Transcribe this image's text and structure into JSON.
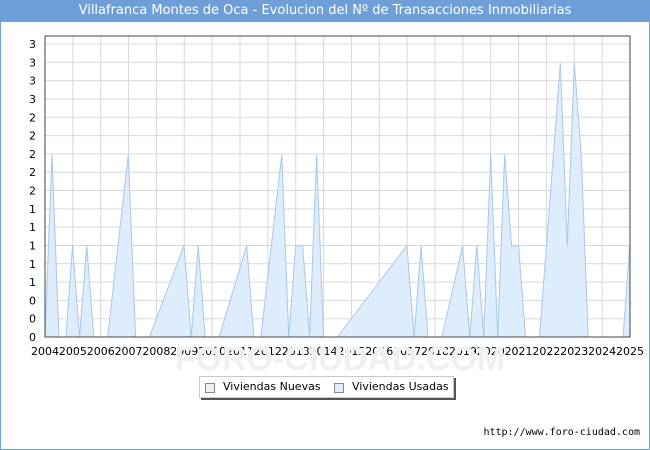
{
  "title": "Villafranca Montes de Oca - Evolucion del Nº de Transacciones Inmobiliarias",
  "watermark": "FORO-CIUDAD.COM",
  "credit": "http://www.foro-ciudad.com",
  "colors": {
    "accent": "#6f9fd8",
    "nuevas_fill": "#f0f0f0",
    "usadas_fill": "#deedfb",
    "usadas_line": "#a8c7ec",
    "grid": "#d8d8d8"
  },
  "chart_data": {
    "type": "area",
    "title": "Villafranca Montes de Oca - Evolucion del Nº de Transacciones Inmobiliarias",
    "xlabel": "",
    "ylabel": "",
    "x_ticks": [
      "2004",
      "2005",
      "2006",
      "2007",
      "2008",
      "2009",
      "2010",
      "2011",
      "2012",
      "2013",
      "2014",
      "2015",
      "2016",
      "2017",
      "2018",
      "2019",
      "2020",
      "2021",
      "2022",
      "2023",
      "2024",
      "2025"
    ],
    "y_ticks": [
      "0",
      "0",
      "0",
      "1",
      "1",
      "1",
      "1",
      "1",
      "2",
      "2",
      "2",
      "2",
      "2",
      "3",
      "3",
      "3",
      "3"
    ],
    "ylim": [
      0,
      3.3
    ],
    "grid": true,
    "legend": "bottom-center",
    "series": [
      {
        "name": "Viviendas Nuevas",
        "x": [],
        "values": []
      },
      {
        "name": "Viviendas Usadas",
        "x": [
          2004.0,
          2004.25,
          2004.5,
          2004.75,
          2004.99,
          2005.24,
          2005.5,
          2005.75,
          2006.0,
          2006.25,
          2006.99,
          2007.25,
          2007.5,
          2007.75,
          2008.99,
          2009.25,
          2009.5,
          2009.75,
          2010.0,
          2010.25,
          2011.24,
          2011.5,
          2011.75,
          2012.5,
          2012.75,
          2013.0,
          2013.25,
          2013.5,
          2013.75,
          2014.0,
          2014.25,
          2014.5,
          2016.99,
          2017.25,
          2017.5,
          2017.75,
          2018.0,
          2018.25,
          2018.99,
          2019.25,
          2019.5,
          2019.75,
          2020.0,
          2020.25,
          2020.5,
          2020.75,
          2021.0,
          2021.25,
          2021.5,
          2021.75,
          2022.5,
          2022.75,
          2023.0,
          2023.25,
          2023.5,
          2023.75,
          2024.75,
          2024.99
        ],
        "values": [
          0,
          2,
          0,
          0,
          1,
          0,
          1,
          0,
          0,
          0,
          2,
          0,
          0,
          0,
          1,
          0,
          1,
          0,
          0,
          0,
          1,
          0,
          0,
          2,
          0,
          1,
          1,
          0,
          2,
          0,
          0,
          0,
          1,
          0,
          1,
          0,
          0,
          0,
          1,
          0,
          1,
          0,
          2,
          0,
          2,
          1,
          1,
          0,
          0,
          0,
          3,
          1,
          3,
          2,
          0,
          0,
          0,
          1
        ]
      }
    ]
  }
}
